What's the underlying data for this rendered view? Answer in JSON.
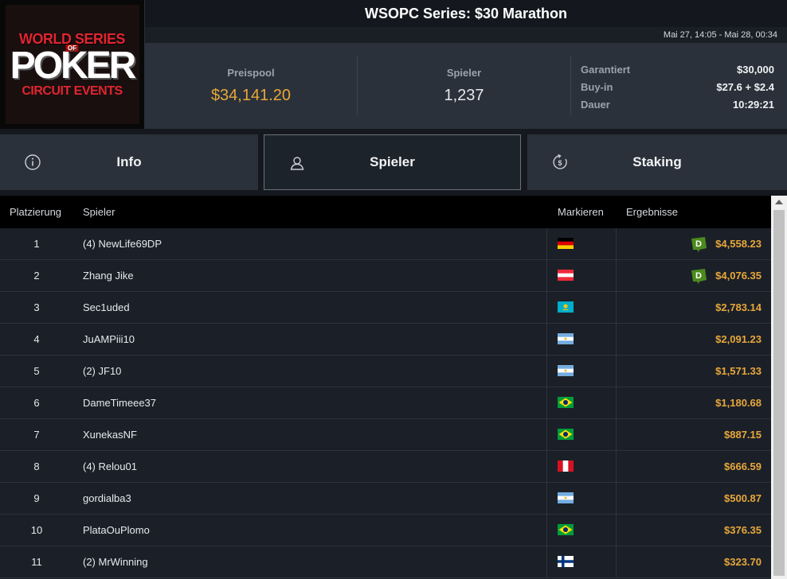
{
  "logo": {
    "line1": "WORLD SERIES",
    "of": "OF",
    "line2": "POKER",
    "line3": "CIRCUIT EVENTS"
  },
  "header": {
    "title": "WSOPC Series: $30 Marathon",
    "date_range": "Mai 27, 14:05 - Mai 28, 00:34"
  },
  "stats": {
    "prizepool_label": "Preispool",
    "prizepool_value": "$34,141.20",
    "players_label": "Spieler",
    "players_value": "1,237",
    "guaranteed_label": "Garantiert",
    "guaranteed_value": "$30,000",
    "buyin_label": "Buy-in",
    "buyin_value": "$27.6 + $2.4",
    "duration_label": "Dauer",
    "duration_value": "10:29:21"
  },
  "tabs": [
    {
      "label": "Info",
      "icon": "info-icon"
    },
    {
      "label": "Spieler",
      "icon": "user-icon",
      "active": true
    },
    {
      "label": "Staking",
      "icon": "dollar-cycle-icon"
    }
  ],
  "table": {
    "headers": {
      "rank": "Platzierung",
      "player": "Spieler",
      "flag": "Markieren",
      "result": "Ergebnisse"
    },
    "rows": [
      {
        "rank": "1",
        "player": "(4) NewLife69DP",
        "flag": "germany",
        "result": "$4,558.23",
        "badge": true
      },
      {
        "rank": "2",
        "player": "Zhang Jike",
        "flag": "austria",
        "result": "$4,076.35",
        "badge": true
      },
      {
        "rank": "3",
        "player": "Sec1uded",
        "flag": "kazakhstan",
        "result": "$2,783.14"
      },
      {
        "rank": "4",
        "player": "JuAMPiii10",
        "flag": "argentina",
        "result": "$2,091.23"
      },
      {
        "rank": "5",
        "player": "(2) JF10",
        "flag": "argentina",
        "result": "$1,571.33"
      },
      {
        "rank": "6",
        "player": "DameTimeee37",
        "flag": "brazil",
        "result": "$1,180.68"
      },
      {
        "rank": "7",
        "player": "XunekasNF",
        "flag": "brazil",
        "result": "$887.15"
      },
      {
        "rank": "8",
        "player": "(4) Relou01",
        "flag": "peru",
        "result": "$666.59"
      },
      {
        "rank": "9",
        "player": "gordialba3",
        "flag": "argentina",
        "result": "$500.87"
      },
      {
        "rank": "10",
        "player": "PlataOuPlomo",
        "flag": "brazil",
        "result": "$376.35"
      },
      {
        "rank": "11",
        "player": "(2) MrWinning",
        "flag": "finland",
        "result": "$323.70"
      }
    ]
  },
  "badge_letter": "D",
  "colors": {
    "accent_gold": "#e8a73a",
    "badge_green": "#4c8a1e"
  }
}
